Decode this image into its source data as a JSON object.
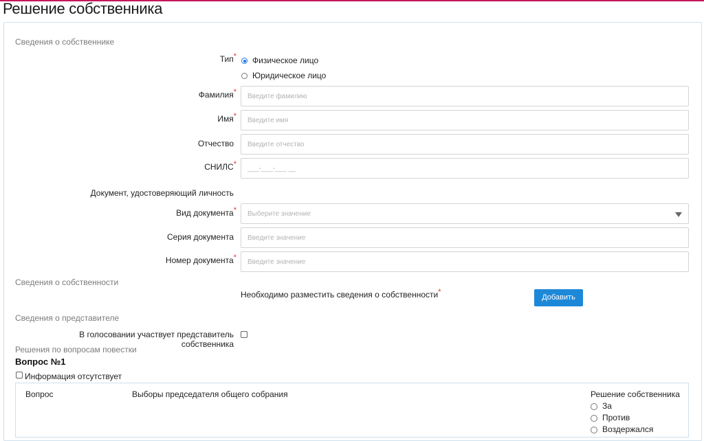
{
  "page_title": "Решение собственника",
  "owner_section": {
    "title": "Сведения о собственнике",
    "type_label": "Тип",
    "type_options": [
      {
        "label": "Физическое лицо",
        "checked": true
      },
      {
        "label": "Юридическое лицо",
        "checked": false
      }
    ],
    "surname": {
      "label": "Фамилия",
      "placeholder": "Введите фамилию"
    },
    "name": {
      "label": "Имя",
      "placeholder": "Введите имя"
    },
    "patronymic": {
      "label": "Отчество",
      "placeholder": "Введите отчество"
    },
    "snils": {
      "label": "СНИЛС",
      "placeholder": "___-___-___ __"
    },
    "id_document_heading": "Документ, удостоверяющий личность",
    "doc_type": {
      "label": "Вид документа",
      "placeholder": "Выберите значение"
    },
    "doc_series": {
      "label": "Серия документа",
      "placeholder": "Введите значение"
    },
    "doc_number": {
      "label": "Номер документа",
      "placeholder": "Введите значение"
    }
  },
  "property_section": {
    "title": "Сведения о собственности",
    "notice": "Необходимо разместить сведения о собственности",
    "add_button": "Добавить"
  },
  "representative_section": {
    "title": "Сведения о представителе",
    "checkbox_label": "В голосовании участвует представитель собственника"
  },
  "agenda_section": {
    "title": "Решения по вопросам повестки",
    "question_title": "Вопрос №1",
    "no_info_label": "Информация отсутствует",
    "table": {
      "question_header": "Вопрос",
      "question_text": "Выборы председателя общего собрания",
      "decision_header": "Решение собственника",
      "options": [
        "За",
        "Против",
        "Воздержался"
      ]
    }
  },
  "colors": {
    "accent": "#1e88d8",
    "required": "#e0332f",
    "top_line": "#c2185b"
  }
}
